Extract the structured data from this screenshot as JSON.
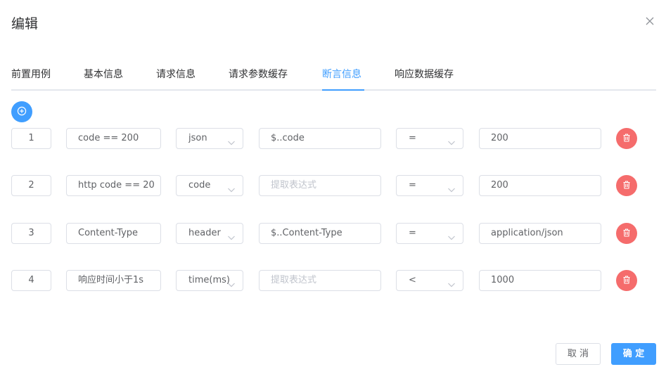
{
  "dialog": {
    "title": "编辑"
  },
  "tabs": [
    {
      "label": "前置用例"
    },
    {
      "label": "基本信息"
    },
    {
      "label": "请求信息"
    },
    {
      "label": "请求参数缓存"
    },
    {
      "label": "断言信息",
      "active": true
    },
    {
      "label": "响应数据缓存"
    }
  ],
  "assertions": [
    {
      "index": "1",
      "name": "code == 200",
      "type": "json",
      "expression": "$..code",
      "expression_placeholder": "提取表达式",
      "operator": "=",
      "expected": "200"
    },
    {
      "index": "2",
      "name": "http code == 20",
      "type": "code",
      "expression": "",
      "expression_placeholder": "提取表达式",
      "operator": "=",
      "expected": "200"
    },
    {
      "index": "3",
      "name": "Content-Type",
      "type": "header",
      "expression": "$..Content-Type",
      "expression_placeholder": "提取表达式",
      "operator": "=",
      "expected": "application/json"
    },
    {
      "index": "4",
      "name": "响应时间小于1s",
      "type": "time(ms)",
      "expression": "",
      "expression_placeholder": "提取表达式",
      "operator": "<",
      "expected": "1000"
    }
  ],
  "footer": {
    "cancel_label": "取 消",
    "confirm_label": "确 定"
  },
  "colors": {
    "primary": "#409eff",
    "danger": "#f56c6c",
    "border": "#dcdfe6"
  },
  "icons": {
    "close": "close-icon",
    "add": "plus-circle-icon",
    "delete": "trash-icon",
    "select": "chevron-down-icon"
  }
}
